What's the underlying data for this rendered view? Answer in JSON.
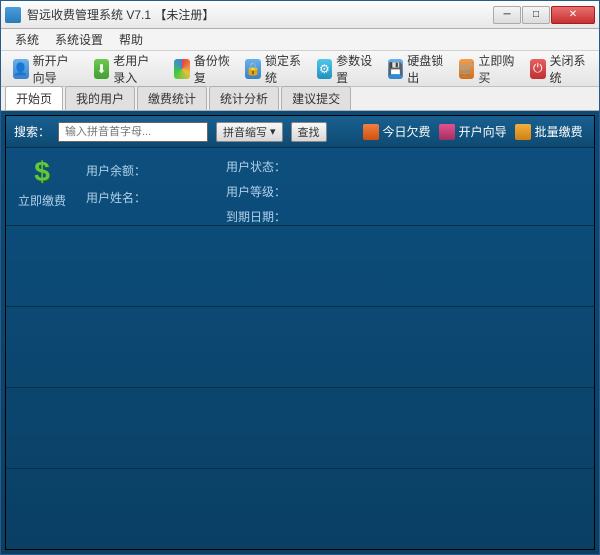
{
  "window": {
    "title": "智远收费管理系统 V7.1 【未注册】"
  },
  "menu": {
    "system": "系统",
    "settings": "系统设置",
    "help": "帮助"
  },
  "toolbar": {
    "new_account": "新开户向导",
    "old_user_import": "老用户录入",
    "backup": "备份恢复",
    "lock": "锁定系统",
    "params": "参数设置",
    "disk": "硬盘锁出",
    "buy": "立即购买",
    "close": "关闭系统"
  },
  "tabs": {
    "start": "开始页",
    "my_users": "我的用户",
    "fee_stats": "缴费统计",
    "stats_analysis": "统计分析",
    "suggest": "建议提交"
  },
  "search": {
    "label": "搜索：",
    "placeholder": "输入拼音首字母...",
    "combo": "拼音缩写",
    "go": "查找",
    "today_arrears": "今日欠费",
    "open_wizard": "开户向导",
    "batch": "批量缴费"
  },
  "panel": {
    "pay_now": "立即缴费",
    "balance": "用户余额：",
    "name": "用户姓名：",
    "status": "用户状态：",
    "level": "用户等级：",
    "expire": "到期日期："
  }
}
